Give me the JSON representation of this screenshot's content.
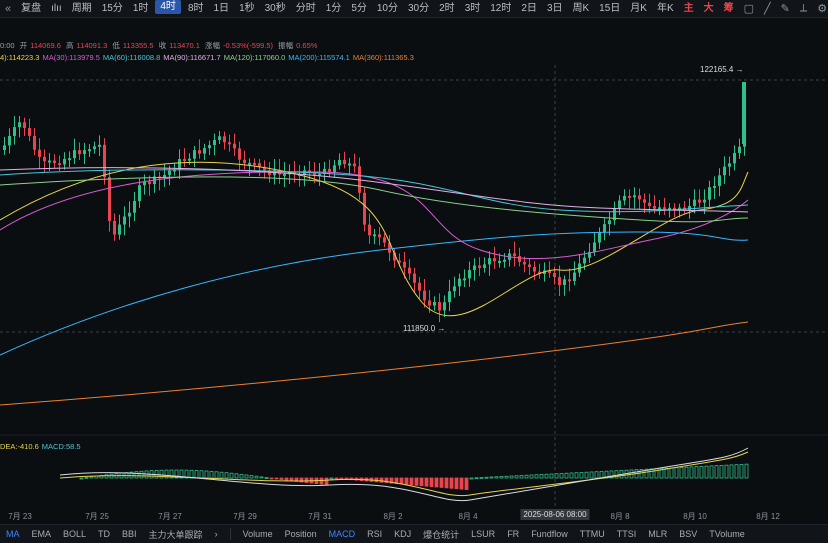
{
  "toolbar": {
    "back_icon": "double-chevron-left-icon",
    "title": "复盘",
    "mode_label": "ılıı",
    "period_label": "周期",
    "timeframes": [
      "15分",
      "1时",
      "4时",
      "8时",
      "1日",
      "1秒",
      "30秒",
      "分时",
      "1分",
      "5分",
      "10分",
      "30分",
      "2时",
      "3时",
      "12时",
      "2日",
      "3日",
      "周K",
      "15日",
      "月K",
      "年K"
    ],
    "active_timeframe": "4时",
    "zhu": "主",
    "da": "大",
    "chou": "筹",
    "time_label": "0s"
  },
  "ohlc_line": {
    "time": "0:00",
    "open_label": "开",
    "open": "114069.6",
    "high_label": "高",
    "high": "114091.3",
    "low_label": "低",
    "low": "113355.5",
    "close_label": "收",
    "close": "113470.1",
    "chg_label": "涨幅",
    "chg": "-0.53%(-599.5)",
    "amp_label": "振幅",
    "amp": "0.65%"
  },
  "ma_line": [
    {
      "label": "4):114223.3",
      "color": "#e8d34a"
    },
    {
      "label": "MA(30):113979.5",
      "color": "#d95bd3"
    },
    {
      "label": "MA(60):116008.8",
      "color": "#46c7d8"
    },
    {
      "label": "MA(90):116671.7",
      "color": "#e0b0e8"
    },
    {
      "label": "MA(120):117060.0",
      "color": "#8bd08b"
    },
    {
      "label": "MA(200):115574.1",
      "color": "#37b7ff"
    },
    {
      "label": "MA(360):111365.3",
      "color": "#f07f2f"
    }
  ],
  "macd_line": [
    {
      "label": "DEA:-410.6",
      "color": "#e8d34a"
    },
    {
      "label": "MACD:58.5",
      "color": "#46c7d8"
    }
  ],
  "chart_data": {
    "type": "candlestick",
    "high_label": "122165.4",
    "low_label": "111850.0",
    "x_labels": [
      "7月 23",
      "7月 25",
      "7月 27",
      "7月 29",
      "7月 31",
      "8月 2",
      "8月 4",
      "2025-08-06 08:00",
      "8月 8",
      "8月 10",
      "8月 12"
    ],
    "selected_date": "2025-08-06 08:00",
    "up_color": "#2fbf8a",
    "down_color": "#e8454f"
  },
  "indicator_tabs": [
    "MA",
    "EMA",
    "BOLL",
    "TD",
    "BBI",
    "主力大单跟踪",
    "›",
    "Volume",
    "Position",
    "MACD",
    "RSI",
    "KDJ",
    "爆仓统计",
    "LSUR",
    "FR",
    "Fundflow",
    "TTMU",
    "TTSI",
    "MLR",
    "BSV",
    "TVolume"
  ],
  "active_main_tab": "MA",
  "active_sub_tab": "MACD"
}
